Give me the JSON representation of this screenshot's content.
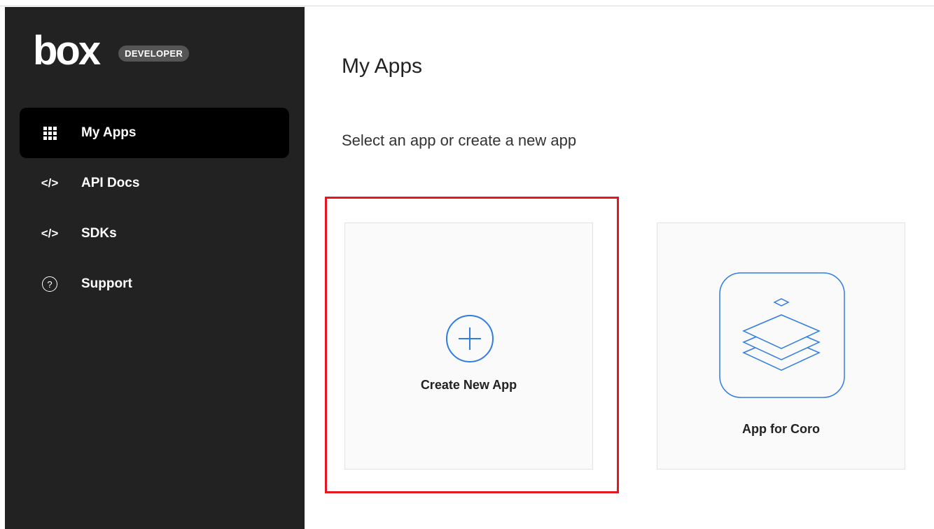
{
  "sidebar": {
    "logo_text": "box",
    "badge": "DEVELOPER",
    "items": [
      {
        "label": "My Apps",
        "icon": "grid-icon",
        "active": true
      },
      {
        "label": "API Docs",
        "icon": "code-icon",
        "active": false
      },
      {
        "label": "SDKs",
        "icon": "code-icon",
        "active": false
      },
      {
        "label": "Support",
        "icon": "help-icon",
        "active": false
      }
    ],
    "code_glyph": "</>",
    "help_glyph": "?"
  },
  "main": {
    "title": "My Apps",
    "subtitle": "Select an app or create a new app",
    "cards": [
      {
        "label": "Create New App",
        "icon": "plus-circle-icon"
      },
      {
        "label": "App for Coro",
        "icon": "layers-icon"
      }
    ]
  },
  "colors": {
    "sidebar_bg": "#222222",
    "active_bg": "#000000",
    "accent_blue": "#2f7ce5",
    "highlight_red": "#e8141f"
  }
}
